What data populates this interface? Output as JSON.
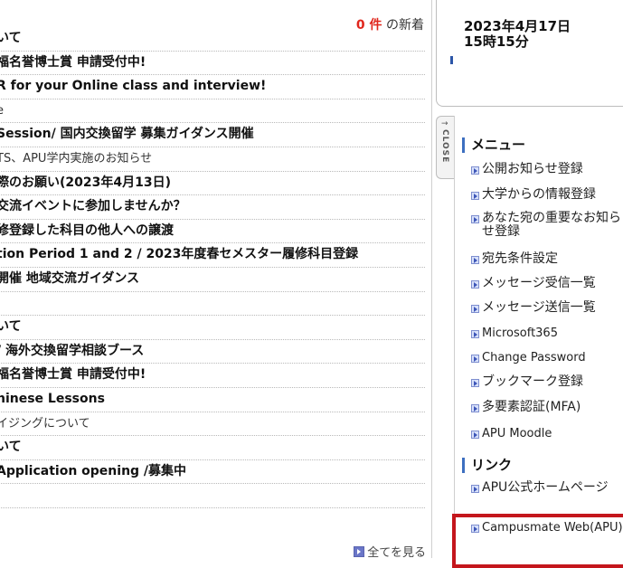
{
  "news": {
    "count_value": "0 件",
    "count_suffix": " の新着",
    "see_all": "全てを見る",
    "items": [
      {
        "text": "いて",
        "bold": true
      },
      {
        "text": "福名誉博士賞 申請受付中!",
        "bold": true
      },
      {
        "text": "R for your Online class and interview!",
        "bold": true
      },
      {
        "text": "e",
        "bold": false
      },
      {
        "text": "Session/ 国内交換留学 募集ガイダンス開催",
        "bold": true
      },
      {
        "text": "TS、APU学内実施のお知らせ",
        "bold": false
      },
      {
        "text": "際のお願い(2023年4月13日)",
        "bold": true
      },
      {
        "text": "交流イベントに参加しませんか？",
        "bold": true
      },
      {
        "text": "修登録した科目の他人への譲渡",
        "bold": true
      },
      {
        "text": "tion Period 1 and 2 / 2023年度春セメスター履修科目登録",
        "bold": true
      },
      {
        "text": "開催 地域交流ガイダンス",
        "bold": true
      },
      {
        "text": "",
        "bold": false
      },
      {
        "text": "いて",
        "bold": true
      },
      {
        "text": "/ 海外交換留学相談ブース",
        "bold": true
      },
      {
        "text": "福名誉博士賞 申請受付中!",
        "bold": true
      },
      {
        "text": "hinese Lessons",
        "bold": true
      },
      {
        "text": "イジングについて",
        "bold": false
      },
      {
        "text": "いて",
        "bold": true
      },
      {
        "text": " Application opening /募集中",
        "bold": true
      },
      {
        "text": "",
        "bold": false
      }
    ]
  },
  "datebox": {
    "date": "2023年4月17日",
    "time": "15時15分"
  },
  "close_tab": {
    "label": "CLOSE",
    "arrow": "→"
  },
  "menu": {
    "heading": "メニュー",
    "items": [
      "公開お知らせ登録",
      "大学からの情報登録",
      "あなた宛の重要なお知らせ登録",
      "宛先条件設定",
      "メッセージ受信一覧",
      "メッセージ送信一覧",
      "Microsoft365",
      "Change Password",
      "ブックマーク登録",
      "多要素認証(MFA)",
      "APU Moodle"
    ]
  },
  "links": {
    "heading": "リンク",
    "items": [
      "APU公式ホームページ",
      "Campusmate Web(APU)"
    ]
  },
  "colors": {
    "count_red": "#e0261c",
    "accent_blue": "#3d6fc0",
    "highlight_red": "#c4161c"
  }
}
